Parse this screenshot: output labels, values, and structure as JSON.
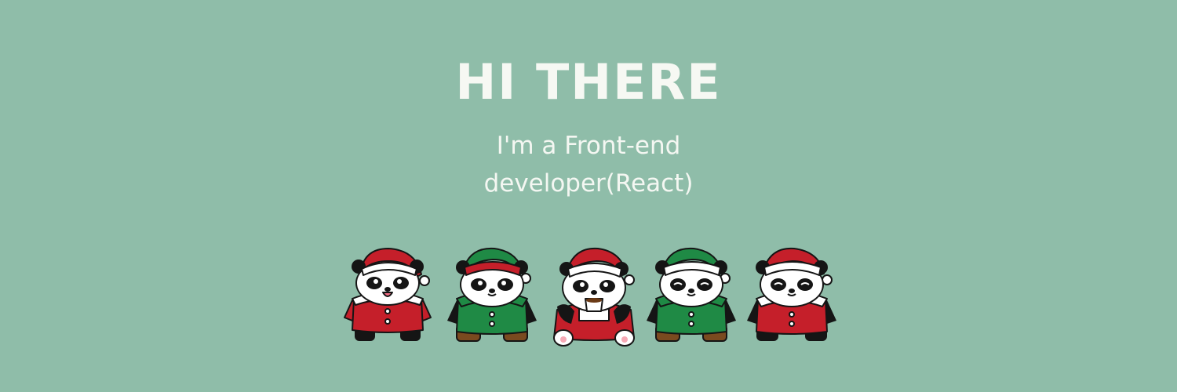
{
  "banner": {
    "title": "HI THERE",
    "subtitle_line1": "I'm a Front-end",
    "subtitle_line2": "developer(React)"
  },
  "colors": {
    "background": "#8fbda9",
    "text": "#f6f8f3",
    "santa_red": "#c51f2a",
    "elf_green": "#1f8a45",
    "fur_white": "#ffffff",
    "panda_black": "#151515"
  },
  "characters": [
    {
      "name": "panda-santa-smiling",
      "outfit": "red"
    },
    {
      "name": "panda-elf",
      "outfit": "green"
    },
    {
      "name": "panda-santa-coffee",
      "outfit": "red"
    },
    {
      "name": "panda-elf-sleeping",
      "outfit": "green"
    },
    {
      "name": "panda-santa-sleeping",
      "outfit": "red"
    }
  ]
}
